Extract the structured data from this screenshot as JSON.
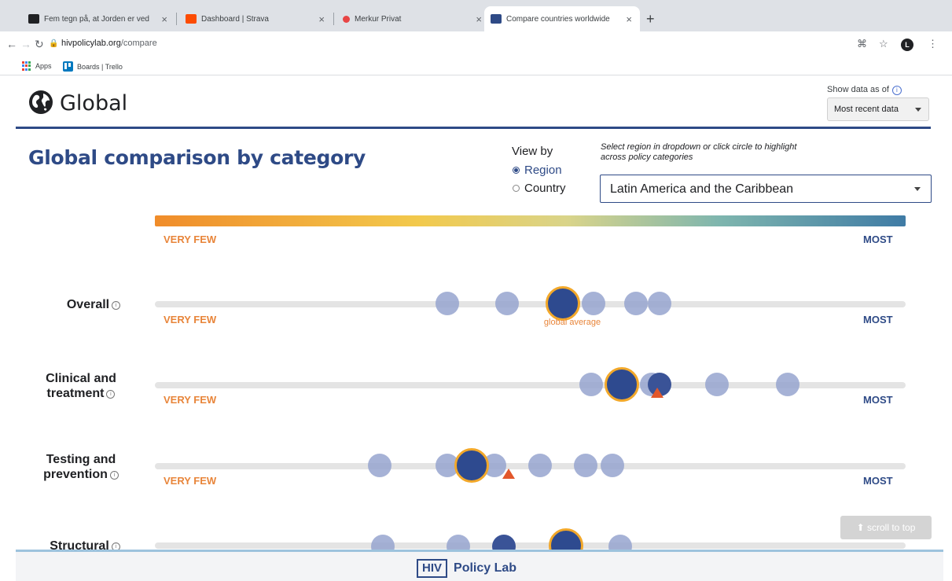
{
  "browser": {
    "tabs": [
      {
        "title": "Fem tegn på, at Jorden er ved",
        "fav_color": "#202124"
      },
      {
        "title": "Dashboard | Strava",
        "fav_color": "#fc4c02"
      },
      {
        "title": "Merkur Privat",
        "fav_color": "#e84545"
      },
      {
        "title": "Compare countries worldwide",
        "fav_color": "#2e4a86"
      }
    ],
    "url_host": "hivpolicylab.org",
    "url_path": "/compare",
    "profile_initial": "L",
    "bookmarks": [
      {
        "label": "Apps",
        "icon": "apps-grid-icon"
      },
      {
        "label": "Boards | Trello",
        "icon": "trello-icon"
      }
    ]
  },
  "header": {
    "brand": "Global",
    "show_data_label": "Show data as of",
    "date_select": "Most recent data"
  },
  "controls": {
    "title": "Global comparison by category",
    "view_by": "View by",
    "options": [
      "Region",
      "Country"
    ],
    "selected": "Region",
    "hint": "Select region in dropdown or click circle to highlight across policy categories",
    "region": "Latin America and the Caribbean"
  },
  "scale": {
    "low": "VERY FEW",
    "high": "MOST",
    "colors": {
      "low": "#f08c2a",
      "high": "#3f7ba5"
    }
  },
  "global_average_label": "global average",
  "categories": [
    {
      "name": "Overall",
      "label": "Overall"
    },
    {
      "name": "Clinical and treatment",
      "label": "Clinical and treatment"
    },
    {
      "name": "Testing and prevention",
      "label": "Testing and prevention"
    },
    {
      "name": "Structural",
      "label": "Structural"
    }
  ],
  "scroll_to_top": "scroll to top",
  "footer": {
    "hiv": "HIV",
    "text": "Policy Lab"
  },
  "colors": {
    "accent": "#2e4a86",
    "highlight_ring": "#f2a82a",
    "global_marker": "#e2572b",
    "circle": "#97a4cf"
  }
}
